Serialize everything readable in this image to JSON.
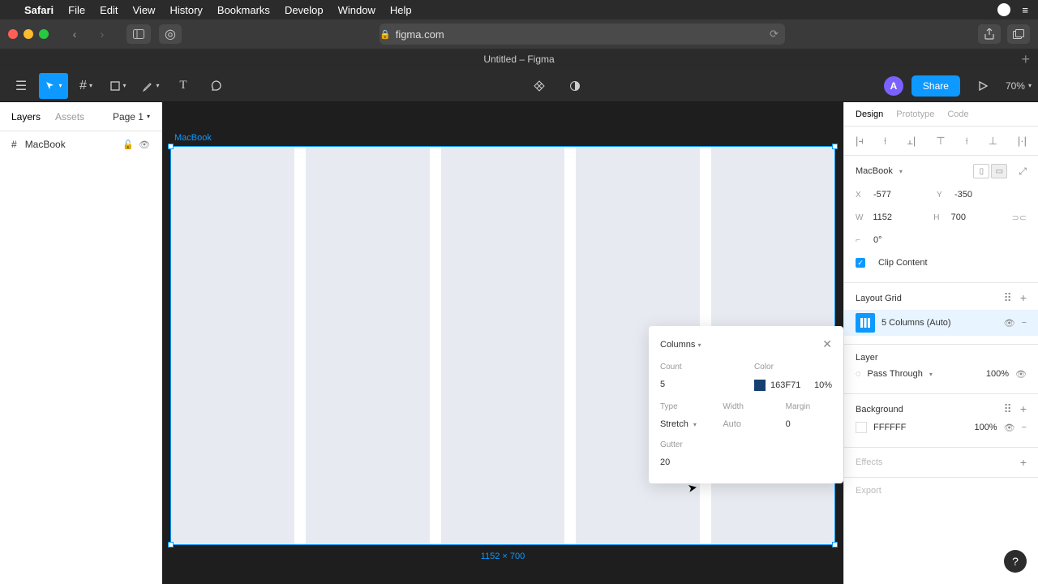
{
  "menubar": {
    "app": "Safari",
    "items": [
      "File",
      "Edit",
      "View",
      "History",
      "Bookmarks",
      "Develop",
      "Window",
      "Help"
    ]
  },
  "browser": {
    "url": "figma.com",
    "tab_title": "Untitled – Figma"
  },
  "figma": {
    "share": "Share",
    "zoom": "70%",
    "avatar": "A",
    "left": {
      "tabs": {
        "layers": "Layers",
        "assets": "Assets",
        "page": "Page 1"
      },
      "layer": "MacBook"
    },
    "canvas": {
      "frame_name": "MacBook",
      "dims": "1152 × 700"
    },
    "right": {
      "tabs": {
        "design": "Design",
        "prototype": "Prototype",
        "code": "Code"
      },
      "frame_name": "MacBook",
      "x": "-577",
      "y": "-350",
      "w": "1152",
      "h": "700",
      "rot": "0°",
      "clip": "Clip Content",
      "layout_grid": "Layout Grid",
      "grid_item": "5 Columns (Auto)",
      "layer_section": "Layer",
      "blend": "Pass Through",
      "blend_opacity": "100%",
      "bg_section": "Background",
      "bg_hex": "FFFFFF",
      "bg_opacity": "100%",
      "effects": "Effects",
      "export": "Export"
    },
    "popup": {
      "title": "Columns",
      "count_label": "Count",
      "count": "5",
      "color_label": "Color",
      "color_hex": "163F71",
      "color_opacity": "10%",
      "type_label": "Type",
      "type": "Stretch",
      "width_label": "Width",
      "width": "Auto",
      "margin_label": "Margin",
      "margin": "0",
      "gutter_label": "Gutter",
      "gutter": "20"
    }
  }
}
